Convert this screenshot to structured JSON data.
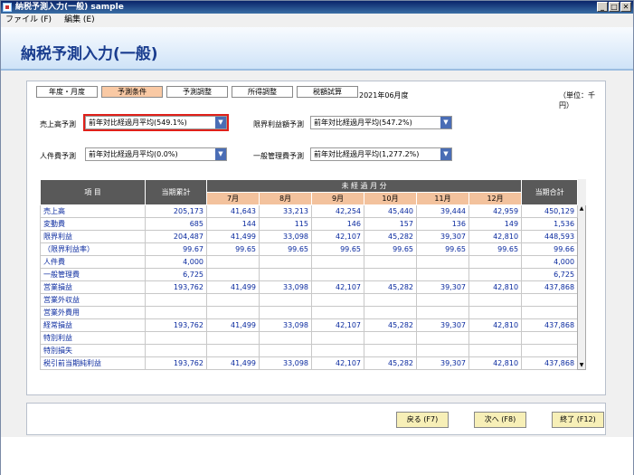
{
  "window": {
    "title": "納税予測入力(一般) sample"
  },
  "menu": [
    {
      "label": "ファイル (F)"
    },
    {
      "label": "編集 (E)"
    }
  ],
  "page_title": "納税予測入力(一般)",
  "tabs": [
    {
      "label": "年度・月度"
    },
    {
      "label": "予測条件"
    },
    {
      "label": "予測調整"
    },
    {
      "label": "所得調整"
    },
    {
      "label": "税額試算"
    }
  ],
  "period": "2021年06月度",
  "unit": "（単位：千円）",
  "filters": {
    "sales": {
      "label": "売上高予測",
      "value": "前年対比経過月平均(549.1%)"
    },
    "margin": {
      "label": "限界利益額予測",
      "value": "前年対比経過月平均(547.2%)"
    },
    "personnel": {
      "label": "人件費予測",
      "value": "前年対比経過月平均(0.0%)"
    },
    "admin": {
      "label": "一般管理費予測",
      "value": "前年対比経過月平均(1,277.2%)"
    }
  },
  "table": {
    "h_item": "項 目",
    "h_cum": "当期累計",
    "h_future": "未 経 過 月 分",
    "h_total": "当期合計",
    "months": [
      "7月",
      "8月",
      "9月",
      "10月",
      "11月",
      "12月"
    ],
    "rows": [
      {
        "label": "売上高",
        "cum": "205,173",
        "m": [
          "41,643",
          "33,213",
          "42,254",
          "45,440",
          "39,444",
          "42,959"
        ],
        "total": "450,129"
      },
      {
        "label": "変動費",
        "cum": "685",
        "m": [
          "144",
          "115",
          "146",
          "157",
          "136",
          "149"
        ],
        "total": "1,536"
      },
      {
        "label": "限界利益",
        "cum": "204,487",
        "m": [
          "41,499",
          "33,098",
          "42,107",
          "45,282",
          "39,307",
          "42,810"
        ],
        "total": "448,593"
      },
      {
        "label": "（限界利益率）",
        "cum": "99.67",
        "m": [
          "99.65",
          "99.65",
          "99.65",
          "99.65",
          "99.65",
          "99.65"
        ],
        "total": "99.66"
      },
      {
        "label": "人件費",
        "cum": "4,000",
        "m": [
          "",
          "",
          "",
          "",
          "",
          ""
        ],
        "total": "4,000"
      },
      {
        "label": "一般管理費",
        "cum": "6,725",
        "m": [
          "",
          "",
          "",
          "",
          "",
          ""
        ],
        "total": "6,725"
      },
      {
        "label": "営業損益",
        "cum": "193,762",
        "m": [
          "41,499",
          "33,098",
          "42,107",
          "45,282",
          "39,307",
          "42,810"
        ],
        "total": "437,868"
      },
      {
        "label": "営業外収益",
        "cum": "",
        "m": [
          "",
          "",
          "",
          "",
          "",
          ""
        ],
        "total": ""
      },
      {
        "label": "営業外費用",
        "cum": "",
        "m": [
          "",
          "",
          "",
          "",
          "",
          ""
        ],
        "total": ""
      },
      {
        "label": "経常損益",
        "cum": "193,762",
        "m": [
          "41,499",
          "33,098",
          "42,107",
          "45,282",
          "39,307",
          "42,810"
        ],
        "total": "437,868"
      },
      {
        "label": "特別利益",
        "cum": "",
        "m": [
          "",
          "",
          "",
          "",
          "",
          ""
        ],
        "total": ""
      },
      {
        "label": "特別損失",
        "cum": "",
        "m": [
          "",
          "",
          "",
          "",
          "",
          ""
        ],
        "total": ""
      },
      {
        "label": "税引前当期純利益",
        "cum": "193,762",
        "m": [
          "41,499",
          "33,098",
          "42,107",
          "45,282",
          "39,307",
          "42,810"
        ],
        "total": "437,868"
      }
    ]
  },
  "buttons": {
    "back": "戻る (F7)",
    "next": "次へ (F8)",
    "end": "終了 (F12)"
  }
}
